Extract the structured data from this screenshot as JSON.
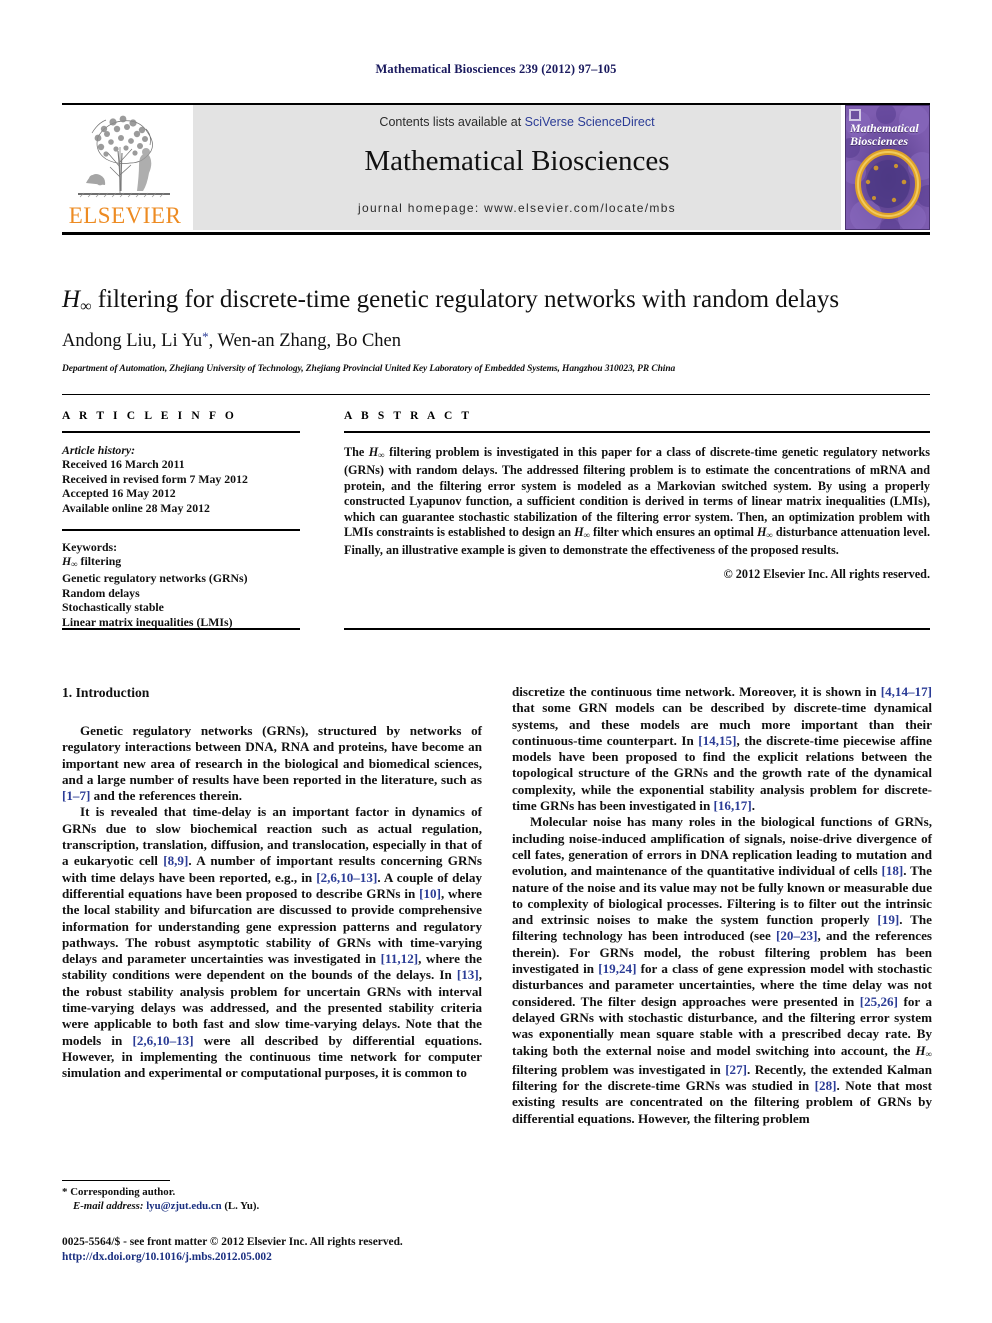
{
  "running_head": "Mathematical Biosciences 239 (2012) 97–105",
  "header": {
    "publisher_name": "ELSEVIER",
    "contents_prefix": "Contents lists available at ",
    "contents_link": "SciVerse ScienceDirect",
    "journal_title": "Mathematical Biosciences",
    "homepage_line": "journal homepage: www.elsevier.com/locate/mbs",
    "cover_title_line1": "Mathematical",
    "cover_title_line2": "Biosciences"
  },
  "title": {
    "prefix_h": "H",
    "prefix_sub": "∞",
    "rest": " filtering for discrete-time genetic regulatory networks with random delays"
  },
  "authors": {
    "line": "Andong Liu, Li Yu",
    "corresponding_marker": "*",
    "line_rest": ", Wen-an Zhang, Bo Chen",
    "affiliation": "Department of Automation, Zhejiang University of Technology, Zhejiang Provincial United Key Laboratory of Embedded Systems, Hangzhou 310023, PR China"
  },
  "article_info": {
    "heading": "A R T I C L E   I N F O",
    "history_label": "Article history:",
    "history": [
      "Received 16 March 2011",
      "Received in revised form 7 May 2012",
      "Accepted 16 May 2012",
      "Available online 28 May 2012"
    ],
    "keywords_label": "Keywords:",
    "keywords": [
      "H∞ filtering",
      "Genetic regulatory networks (GRNs)",
      "Random delays",
      "Stochastically stable",
      "Linear matrix inequalities (LMIs)"
    ]
  },
  "abstract": {
    "heading": "A B S T R A C T",
    "text": "The H∞ filtering problem is investigated in this paper for a class of discrete-time genetic regulatory networks (GRNs) with random delays. The addressed filtering problem is to estimate the concentrations of mRNA and protein, and the filtering error system is modeled as a Markovian switched system. By using a properly constructed Lyapunov function, a sufficient condition is derived in terms of linear matrix inequalities (LMIs), which can guarantee stochastic stabilization of the filtering error system. Then, an optimization problem with LMIs constraints is established to design an H∞ filter which ensures an optimal H∞ disturbance attenuation level. Finally, an illustrative example is given to demonstrate the effectiveness of the proposed results.",
    "copyright": "© 2012 Elsevier Inc. All rights reserved."
  },
  "body": {
    "section_heading": "1. Introduction",
    "left_paragraphs": [
      "Genetic regulatory networks (GRNs), structured by networks of regulatory interactions between DNA, RNA and proteins, have become an important new area of research in the biological and biomedical sciences, and a large number of results have been reported in the literature, such as [1–7] and the references therein.",
      "It is revealed that time-delay is an important factor in dynamics of GRNs due to slow biochemical reaction such as actual regulation, transcription, translation, diffusion, and translocation, especially in that of a eukaryotic cell [8,9]. A number of important results concerning GRNs with time delays have been reported, e.g., in [2,6,10–13]. A couple of delay differential equations have been proposed to describe GRNs in [10], where the local stability and bifurcation are discussed to provide comprehensive information for understanding gene expression patterns and regulatory pathways. The robust asymptotic stability of GRNs with time-varying delays and parameter uncertainties was investigated in [11,12], where the stability conditions were dependent on the bounds of the delays. In [13], the robust stability analysis problem for uncertain GRNs with interval time-varying delays was addressed, and the presented stability criteria were applicable to both fast and slow time-varying delays. Note that the models in [2,6,10–13] were all described by differential equations. However, in implementing the continuous time network for computer simulation and experimental or computational purposes, it is common to"
    ],
    "right_paragraphs": [
      "discretize the continuous time network. Moreover, it is shown in [4,14–17] that some GRN models can be described by discrete-time dynamical systems, and these models are much more important than their continuous-time counterpart. In [14,15], the discrete-time piecewise affine models have been proposed to find the explicit relations between the topological structure of the GRNs and the growth rate of the dynamical complexity, while the exponential stability analysis problem for discrete-time GRNs has been investigated in [16,17].",
      "Molecular noise has many roles in the biological functions of GRNs, including noise-induced amplification of signals, noise-drive divergence of cell fates, generation of errors in DNA replication leading to mutation and evolution, and maintenance of the quantitative individual of cells [18]. The nature of the noise and its value may not be fully known or measurable due to complexity of biological processes. Filtering is to filter out the intrinsic and extrinsic noises to make the system function properly [19]. The filtering technology has been introduced (see [20–23], and the references therein). For GRNs model, the robust filtering problem has been investigated in [19,24] for a class of gene expression model with stochastic disturbances and parameter uncertainties, where the time delay was not considered. The filter design approaches were presented in [25,26] for a delayed GRNs with stochastic disturbance, and the filtering error system was exponentially mean square stable with a prescribed decay rate. By taking both the external noise and model switching into account, the H∞ filtering problem was investigated in [27]. Recently, the extended Kalman filtering for the discrete-time GRNs was studied in [28]. Note that most existing results are concentrated on the filtering problem of GRNs by differential equations. However, the filtering problem"
    ]
  },
  "footnote": {
    "corresponding_marker": "*",
    "corresponding_text": "Corresponding author.",
    "email_label": "E-mail address:",
    "email": "lyu@zjut.edu.cn",
    "email_owner": "(L. Yu)."
  },
  "imprint": {
    "line1": "0025-5564/$ - see front matter © 2012 Elsevier Inc. All rights reserved.",
    "doi": "http://dx.doi.org/10.1016/j.mbs.2012.05.002"
  },
  "colors": {
    "running_head": "#1a1a5e",
    "link": "#2b3c96",
    "elsevier_orange": "#ED8B22",
    "banner_gray": "#e3e3e3",
    "cover_purple": "#6d4fa0"
  }
}
